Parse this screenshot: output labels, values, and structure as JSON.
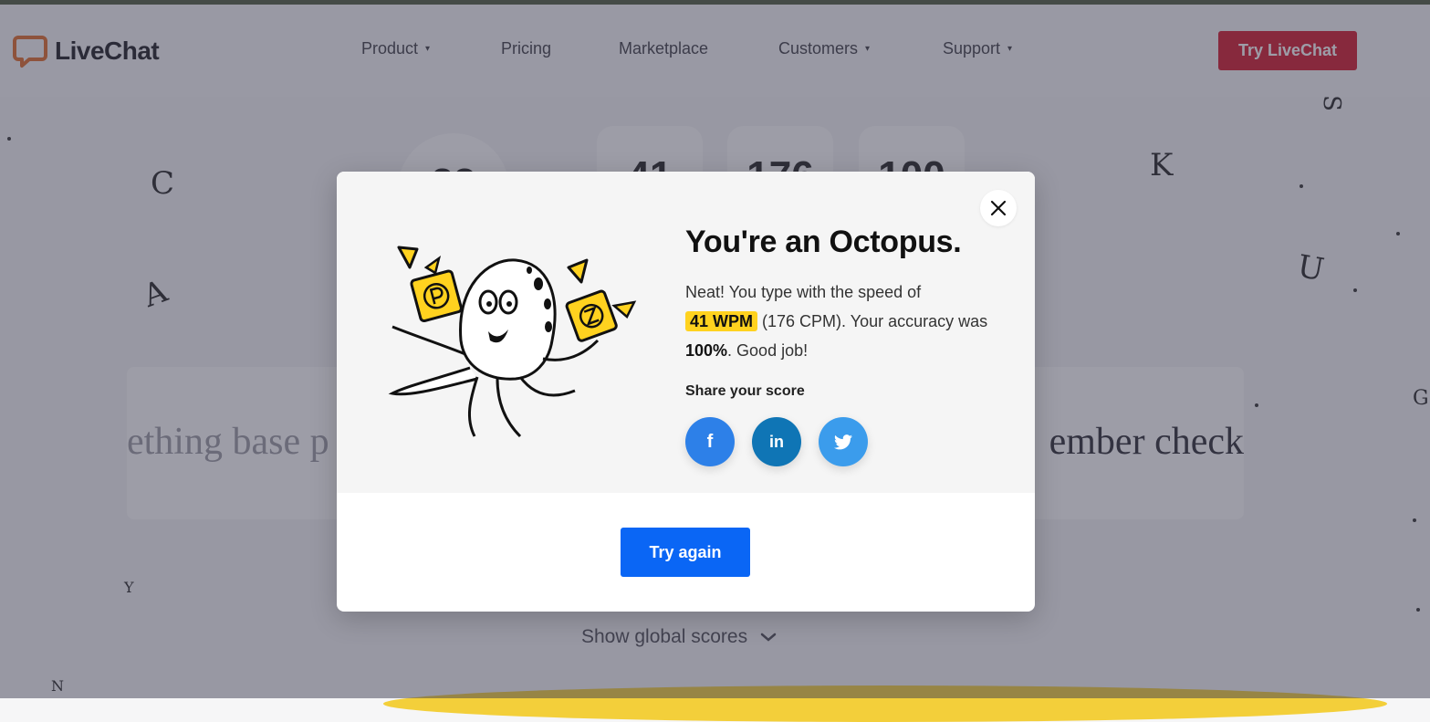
{
  "header": {
    "logo_text": "LiveChat",
    "nav": [
      {
        "label": "Product",
        "has_caret": true
      },
      {
        "label": "Pricing",
        "has_caret": false
      },
      {
        "label": "Marketplace",
        "has_caret": false
      },
      {
        "label": "Customers",
        "has_caret": true
      },
      {
        "label": "Support",
        "has_caret": true
      }
    ],
    "cta_label": "Try LiveChat",
    "caret": "▾"
  },
  "background": {
    "timer_value": "23",
    "stats": [
      "41",
      "176",
      "100"
    ],
    "typing_left": "ething base p",
    "typing_right": "ember check",
    "global_scores_label": "Show global scores",
    "deco_letters": [
      "C",
      "A",
      "K",
      "U",
      "S",
      "G",
      "Y",
      "N"
    ]
  },
  "modal": {
    "title": "You're an Octopus.",
    "body_pre": "Neat! You type with the speed of",
    "wpm": "41 WPM",
    "body_mid": " (176 CPM). Your accuracy was ",
    "accuracy": "100%",
    "body_post": ". Good job!",
    "share_label": "Share your score",
    "share": {
      "facebook": "f",
      "linkedin": "in"
    },
    "try_again_label": "Try again"
  },
  "colors": {
    "brand_orange": "#e06b28",
    "cta_red": "#d2162b",
    "primary_blue": "#0a66f5",
    "highlight_yellow": "#ffd21f",
    "facebook": "#2d80e8",
    "linkedin": "#0f75b5",
    "twitter": "#3b9cec"
  },
  "icons": [
    "livechat-logo-icon",
    "close-icon",
    "facebook-icon",
    "linkedin-icon",
    "twitter-icon",
    "chevron-down-icon",
    "octopus-illustration"
  ]
}
